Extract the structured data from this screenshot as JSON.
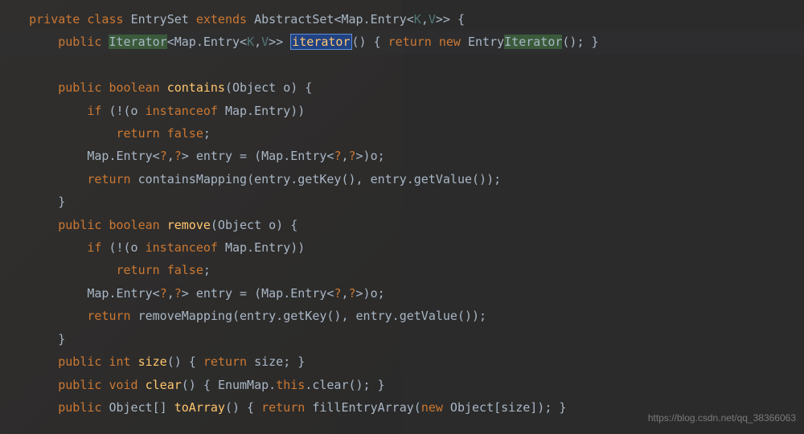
{
  "code": {
    "line1": {
      "indent": "    ",
      "kw_private": "private",
      "kw_class": "class",
      "class_name": "EntrySet",
      "kw_extends": "extends",
      "parent": "AbstractSet",
      "generic": "<Map.Entry<",
      "k": "K",
      "comma": ",",
      "v": "V",
      "generic_close": ">>",
      "brace": " {"
    },
    "line2": {
      "indent": "        ",
      "kw_public": "public",
      "iterator_type": "Iterator",
      "generic": "<Map.Entry<",
      "k": "K",
      "comma": ",",
      "v": "V",
      "generic_close": ">>",
      "method": "iterator",
      "parens": "()",
      "brace_open": " { ",
      "kw_return": "return",
      "kw_new": "new",
      "entry_type": "Entry",
      "iterator_suffix": "Iterator",
      "parens2": "()",
      "semi": "; }"
    },
    "line4": {
      "indent": "        ",
      "kw_public": "public",
      "kw_boolean": "boolean",
      "method": "contains",
      "params": "(Object o) {"
    },
    "line5": {
      "indent": "            ",
      "kw_if": "if",
      "open": " (!(o ",
      "kw_instanceof": "instanceof",
      "rest": " Map.Entry))"
    },
    "line6": {
      "indent": "                ",
      "kw_return": "return",
      "kw_false": "false",
      "semi": ";"
    },
    "line7": {
      "indent": "            ",
      "text": "Map.Entry<",
      "q1": "?",
      "c1": ",",
      "q2": "?",
      "text2": "> entry = (Map.Entry<",
      "q3": "?",
      "c2": ",",
      "q4": "?",
      "text3": ">)o;"
    },
    "line8": {
      "indent": "            ",
      "kw_return": "return",
      "method": " containsMapping",
      "rest": "(entry.getKey(), entry.getValue());"
    },
    "line9": {
      "indent": "        ",
      "brace": "}"
    },
    "line10": {
      "indent": "        ",
      "kw_public": "public",
      "kw_boolean": "boolean",
      "method": "remove",
      "params": "(Object o) {"
    },
    "line11": {
      "indent": "            ",
      "kw_if": "if",
      "open": " (!(o ",
      "kw_instanceof": "instanceof",
      "rest": " Map.Entry))"
    },
    "line12": {
      "indent": "                ",
      "kw_return": "return",
      "kw_false": "false",
      "semi": ";"
    },
    "line13": {
      "indent": "            ",
      "text": "Map.Entry<",
      "q1": "?",
      "c1": ",",
      "q2": "?",
      "text2": "> entry = (Map.Entry<",
      "q3": "?",
      "c2": ",",
      "q4": "?",
      "text3": ">)o;"
    },
    "line14": {
      "indent": "            ",
      "kw_return": "return",
      "method": " removeMapping",
      "rest": "(entry.getKey(), entry.getValue());"
    },
    "line15": {
      "indent": "        ",
      "brace": "}"
    },
    "line16": {
      "indent": "        ",
      "kw_public": "public",
      "kw_int": "int",
      "method": "size",
      "parens": "()",
      "brace_open": " { ",
      "kw_return": "return",
      "rest": " size; }"
    },
    "line17": {
      "indent": "        ",
      "kw_public": "public",
      "kw_void": "void",
      "method": "clear",
      "parens": "()",
      "brace_open": " { ",
      "rest": "EnumMap.",
      "kw_this": "this",
      "rest2": ".clear(); }"
    },
    "line18": {
      "indent": "        ",
      "kw_public": "public",
      "type": "Object[]",
      "method": "toArray",
      "parens": "()",
      "brace_open": " { ",
      "kw_return": "return",
      "method2": " fillEntryArray",
      "open": "(",
      "kw_new": "new",
      "rest": " Object[size]); }"
    }
  },
  "watermark": "https://blog.csdn.net/qq_38366063"
}
